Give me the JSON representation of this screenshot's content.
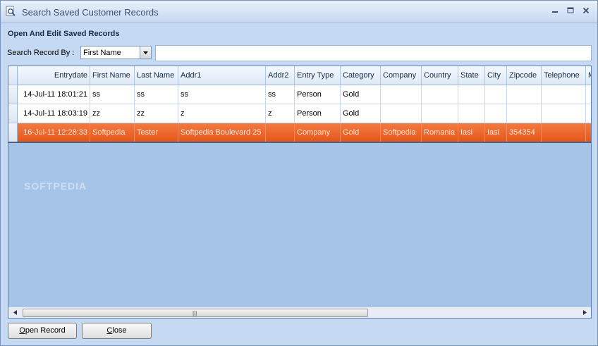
{
  "window": {
    "title": "Search Saved Customer Records",
    "controls": [
      "minimize",
      "maximize",
      "close"
    ]
  },
  "section_title": "Open And Edit Saved Records",
  "search": {
    "label": "Search Record By :",
    "field_selected": "First Name",
    "query": ""
  },
  "grid": {
    "columns": [
      "Entrydate",
      "First Name",
      "Last Name",
      "Addr1",
      "Addr2",
      "Entry Type",
      "Category",
      "Company",
      "Country",
      "State",
      "City",
      "Zipcode",
      "Telephone",
      "M"
    ],
    "rows": [
      {
        "entrydate": "14-Jul-11 18:01:21",
        "first_name": "ss",
        "last_name": "ss",
        "addr1": "ss",
        "addr2": "ss",
        "entry_type": "Person",
        "category": "Gold",
        "company": "",
        "country": "",
        "state": "",
        "city": "",
        "zipcode": "",
        "telephone": ""
      },
      {
        "entrydate": "14-Jul-11 18:03:19",
        "first_name": "zz",
        "last_name": "zz",
        "addr1": "z",
        "addr2": "z",
        "entry_type": "Person",
        "category": "Gold",
        "company": "",
        "country": "",
        "state": "",
        "city": "",
        "zipcode": "",
        "telephone": ""
      },
      {
        "entrydate": "16-Jul-11 12:28:33",
        "first_name": "Softpedia",
        "last_name": "Tester",
        "addr1": "Softpedia Boulevard 25",
        "addr2": "",
        "entry_type": "Company",
        "category": "Gold",
        "company": "Softpedia",
        "country": "Romania",
        "state": "Iasi",
        "city": "Iasi",
        "zipcode": "354354",
        "telephone": ""
      }
    ],
    "selected_row_index": 2
  },
  "watermark": "SOFTPEDIA",
  "buttons": {
    "open_record": {
      "mnemonic": "O",
      "rest": "pen Record"
    },
    "close": {
      "mnemonic": "C",
      "rest": "lose"
    }
  },
  "colors": {
    "selection": "#e8601f",
    "grid_background": "#a6c3e8",
    "window_background": "#c5d9f3"
  }
}
